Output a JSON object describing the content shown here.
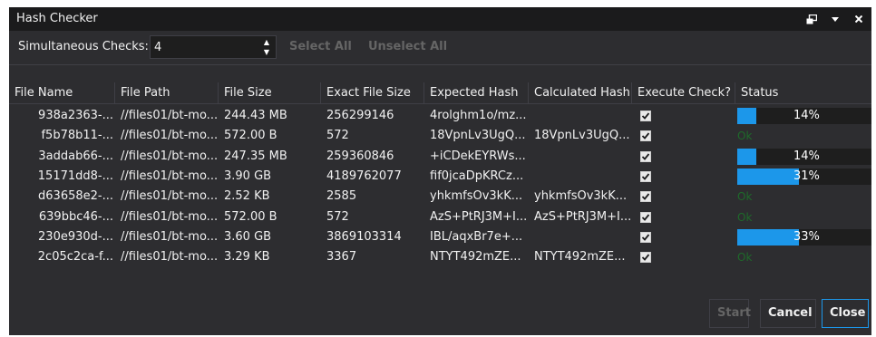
{
  "window": {
    "title": "Hash Checker",
    "icons": [
      "restore-window-icon",
      "dropdown-arrow-icon",
      "close-icon"
    ]
  },
  "toolbar": {
    "simultaneous_label": "Simultaneous Checks:",
    "simultaneous_value": "4",
    "select_all_label": "Select All",
    "unselect_all_label": "Unselect All"
  },
  "grid": {
    "columns": [
      "File Name",
      "File Path",
      "File Size",
      "Exact File Size",
      "Expected Hash",
      "Calculated Hash",
      "Execute Check?",
      "Status"
    ],
    "rows": [
      {
        "name": "938a2363-...",
        "path": "//files01/bt-mo...",
        "size": "244.43 MB",
        "exact": "256299146",
        "expected": "4rolghm1o/mz...",
        "calculated": "",
        "execute": true,
        "status_type": "progress",
        "progress": 14,
        "progress_text": "14%"
      },
      {
        "name": "f5b78b11-...",
        "path": "//files01/bt-mo...",
        "size": "572.00 B",
        "exact": "572",
        "expected": "18VpnLv3UgQ...",
        "calculated": "18VpnLv3UgQ...",
        "execute": true,
        "status_type": "ok",
        "status_text": "Ok"
      },
      {
        "name": "3addab66-...",
        "path": "//files01/bt-mo...",
        "size": "247.35 MB",
        "exact": "259360846",
        "expected": "+iCDekEYRWs...",
        "calculated": "",
        "execute": true,
        "status_type": "progress",
        "progress": 14,
        "progress_text": "14%"
      },
      {
        "name": "15171dd8-...",
        "path": "//files01/bt-mo...",
        "size": "3.90 GB",
        "exact": "4189762077",
        "expected": "fif0jcaDpKRCz...",
        "calculated": "",
        "execute": true,
        "status_type": "progress",
        "progress": 46,
        "progress_text": "31%"
      },
      {
        "name": "d63658e2-...",
        "path": "//files01/bt-mo...",
        "size": "2.52 KB",
        "exact": "2585",
        "expected": "yhkmfsOv3kK...",
        "calculated": "yhkmfsOv3kK...",
        "execute": true,
        "status_type": "ok",
        "status_text": "Ok"
      },
      {
        "name": "639bbc46-...",
        "path": "//files01/bt-mo...",
        "size": "572.00 B",
        "exact": "572",
        "expected": "AzS+PtRJ3M+I...",
        "calculated": "AzS+PtRJ3M+I...",
        "execute": true,
        "status_type": "ok",
        "status_text": "Ok"
      },
      {
        "name": "230e930d-...",
        "path": "//files01/bt-mo...",
        "size": "3.60 GB",
        "exact": "3869103314",
        "expected": "IBL/aqxBr7e+...",
        "calculated": "",
        "execute": true,
        "status_type": "progress",
        "progress": 46,
        "progress_text": "33%"
      },
      {
        "name": "2c05c2ca-f...",
        "path": "//files01/bt-mo...",
        "size": "3.29 KB",
        "exact": "3367",
        "expected": "NTYT492mZE...",
        "calculated": "NTYT492mZE...",
        "execute": true,
        "status_type": "ok",
        "status_text": "Ok"
      }
    ]
  },
  "footer": {
    "start_label": "Start",
    "cancel_label": "Cancel",
    "close_label": "Close"
  },
  "colors": {
    "background": "#2d2d30",
    "titlebar": "#1b1b1c",
    "text": "#f1f1f1",
    "disabled_text": "#656565",
    "progress_fill": "#1c97ea",
    "progress_track": "#1e1e1e",
    "ok_text": "#1e6a2a",
    "accent_border": "#1c97ea"
  }
}
